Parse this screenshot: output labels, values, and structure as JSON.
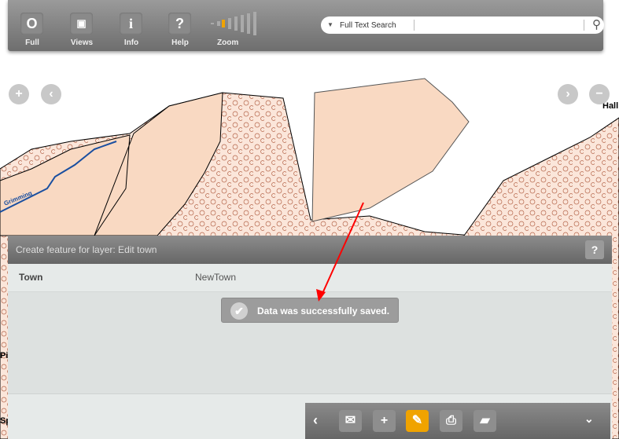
{
  "toolbar": {
    "buttons": [
      {
        "label": "Full",
        "icon": "circle-icon"
      },
      {
        "label": "Views",
        "icon": "views-icon"
      },
      {
        "label": "Info",
        "icon": "info-icon"
      },
      {
        "label": "Help",
        "icon": "help-icon"
      }
    ],
    "zoom_label": "Zoom",
    "zoom_level_index": 2,
    "zoom_levels": 8
  },
  "search": {
    "dropdown": "▼",
    "placeholder": "Full Text Search"
  },
  "map": {
    "labels": {
      "hall": "Hall",
      "river": "Grimming",
      "pi": "Pi",
      "sp": "Sp"
    }
  },
  "panel": {
    "title": "Create feature for layer: Edit town",
    "help": "?",
    "fields": [
      {
        "name": "Town",
        "value": "NewTown"
      }
    ]
  },
  "toast": {
    "message": "Data was successfully saved."
  },
  "bottom_toolbar": {
    "tools": [
      "mail-icon",
      "add-icon",
      "create-feature-icon",
      "print-icon",
      "eraser-icon"
    ],
    "active": "create-feature-icon"
  },
  "colors": {
    "accent": "#f0a300",
    "polygon_fill": "#f9d9c2",
    "arrow": "#ff0000"
  }
}
